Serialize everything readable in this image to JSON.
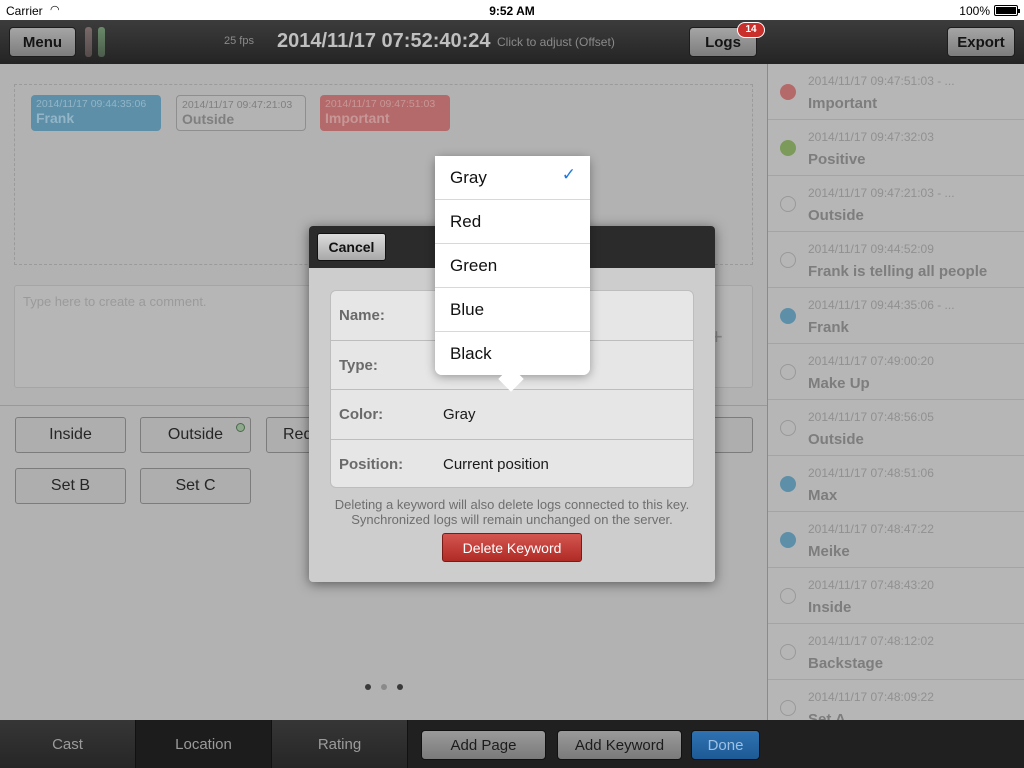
{
  "status_bar": {
    "carrier": "Carrier",
    "time": "9:52 AM",
    "battery": "100%"
  },
  "toolbar": {
    "menu_label": "Menu",
    "fps": "25 fps",
    "timecode": "2014/11/17 07:52:40:24",
    "offset_hint": "Click to adjust (Offset)",
    "logs_label": "Logs",
    "logs_badge": "14",
    "export_label": "Export"
  },
  "main": {
    "tags": [
      {
        "time": "2014/11/17 09:44:35:06",
        "name": "Frank"
      },
      {
        "time": "2014/11/17 09:47:21:03",
        "name": "Outside"
      },
      {
        "time": "2014/11/17 09:47:51:03",
        "name": "Important"
      }
    ],
    "comment_placeholder": "Type here to create a comment.",
    "comment_add": "+",
    "keywords": [
      "Inside",
      "Outside",
      "Red",
      "Set B",
      "Set C"
    ]
  },
  "log_list": [
    {
      "time": "2014/11/17 09:47:51:03 - ...",
      "name": "Important",
      "color": "#b56a6a"
    },
    {
      "time": "2014/11/17 09:47:32:03",
      "name": "Positive",
      "color": "#7c9a5a"
    },
    {
      "time": "2014/11/17 09:47:21:03 - ...",
      "name": "Outside",
      "color": ""
    },
    {
      "time": "2014/11/17 09:44:52:09",
      "name": "Frank is telling all people",
      "color": ""
    },
    {
      "time": "2014/11/17 09:44:35:06 - ...",
      "name": "Frank",
      "color": "#5d8fa9"
    },
    {
      "time": "2014/11/17 07:49:00:20",
      "name": "Make Up",
      "color": ""
    },
    {
      "time": "2014/11/17 07:48:56:05",
      "name": "Outside",
      "color": ""
    },
    {
      "time": "2014/11/17 07:48:51:06",
      "name": "Max",
      "color": "#5d8fa9"
    },
    {
      "time": "2014/11/17 07:48:47:22",
      "name": "Meike",
      "color": "#5d8fa9"
    },
    {
      "time": "2014/11/17 07:48:43:20",
      "name": "Inside",
      "color": ""
    },
    {
      "time": "2014/11/17 07:48:12:02",
      "name": "Backstage",
      "color": ""
    },
    {
      "time": "2014/11/17 07:48:09:22",
      "name": "Set A",
      "color": ""
    }
  ],
  "bottom_bar": {
    "tabs": [
      "Cast",
      "Location",
      "Rating"
    ],
    "add_page": "Add Page",
    "add_keyword": "Add Keyword",
    "done": "Done"
  },
  "modal": {
    "cancel": "Cancel",
    "fields": [
      {
        "label": "Name:",
        "value": ""
      },
      {
        "label": "Type:",
        "value": ""
      },
      {
        "label": "Color:",
        "value": "Gray"
      },
      {
        "label": "Position:",
        "value": "Current position"
      }
    ],
    "note": "Deleting a keyword will also delete logs connected to this key. Synchronized logs will remain unchanged on the server.",
    "delete_label": "Delete Keyword"
  },
  "color_picker": {
    "options": [
      "Gray",
      "Red",
      "Green",
      "Blue",
      "Black"
    ],
    "selected": "Gray",
    "check_icon": "✓"
  }
}
